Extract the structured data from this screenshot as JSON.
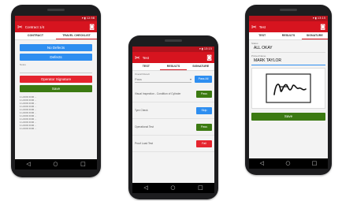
{
  "colors": {
    "brand_red": "#d7141f",
    "blue": "#2e8ef0",
    "green": "#3c7a12",
    "button_red": "#e5252e"
  },
  "phone1": {
    "status_time": "▾ ▮ 12:58",
    "app_title": "Contract 1/4",
    "tabs": [
      "CONTRACT",
      "TRAVEL CHECKLIST"
    ],
    "buttons": {
      "no_defects": "No Defects",
      "defects": "Defects",
      "operator_signature": "Operator Signature",
      "save": "Save"
    },
    "field_label": "Notes",
    "list_lines": [
      "1 LOOK FOR ...",
      "1 LOOK FOR ...",
      "1 LOOK FOR ...",
      "1 LOOK FOR ...",
      "1 LOOK FOR ...",
      "1 LOOK FOR ...",
      "1 LOOK FOR ...",
      "1 LOOK FOR ...",
      "1 LOOK FOR ...",
      "1 LOOK FOR ...",
      "1 LOOK FOR ..."
    ]
  },
  "phone2": {
    "status_time": "▾ ▮ 13:15",
    "app_title": "Test",
    "tabs": [
      "TEST",
      "RESULTS",
      "SIGNATURE"
    ],
    "select_label": "Overall Result",
    "select_value": "Pass",
    "pass_all": "Pass All",
    "rows": [
      {
        "label": "Visual Inspection - Condition of Cylinder",
        "button": "Pass",
        "color": "#3c7a12"
      },
      {
        "label": "Tyre Check",
        "button": "Skip",
        "color": "#2e8ef0"
      },
      {
        "label": "Operational Test",
        "button": "Pass",
        "color": "#3c7a12"
      },
      {
        "label": "Proof Load Test",
        "button": "Fail",
        "color": "#e5252e"
      }
    ]
  },
  "phone3": {
    "status_time": "▾ ▮ 13:15",
    "app_title": "Test",
    "tabs": [
      "TEST",
      "RESULTS",
      "SIGNATURE"
    ],
    "status_label": "Status",
    "status_value": "ALL OKAY",
    "name_label": "Printed Name",
    "name_value": "MARK TAYLOR",
    "save": "Save"
  }
}
